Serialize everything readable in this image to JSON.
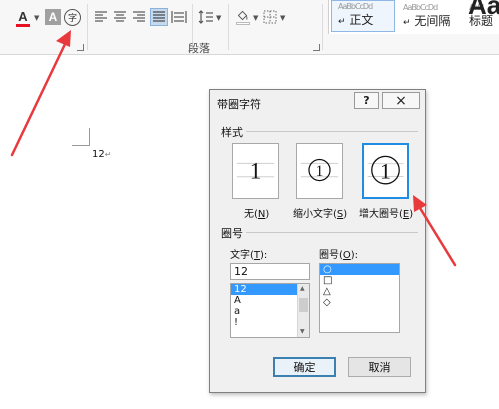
{
  "ribbon": {
    "font_color_label": "A",
    "char_shading_label": "A",
    "enclose_char_label": "字",
    "paragraph_group_label": "段落",
    "styles": [
      {
        "preview": "AaBbCcDd",
        "name": "正文",
        "marker": "↵",
        "selected": true
      },
      {
        "preview": "AaBbCcDd",
        "name": "无间隔",
        "marker": "↵",
        "selected": false
      },
      {
        "preview": "AaBl",
        "name": "标题",
        "selected": false
      }
    ],
    "big_style_glyph": "Aa"
  },
  "document": {
    "text": "12",
    "para_mark": "↵"
  },
  "dialog": {
    "title": "带圈字符",
    "help_label": "?",
    "close_label": "×",
    "style_section": "样式",
    "style_options": [
      {
        "label": "无",
        "hotkey": "N",
        "preview": "1",
        "selected": false
      },
      {
        "label": "缩小文字",
        "hotkey": "S",
        "preview": "1",
        "selected": false
      },
      {
        "label": "增大圈号",
        "hotkey": "E",
        "preview": "1",
        "selected": true
      }
    ],
    "enclosure_section": "圈号",
    "text_field_label": "文字",
    "text_field_hotkey": "T",
    "text_value": "12",
    "text_list": [
      "12",
      "A",
      "a",
      "!"
    ],
    "text_list_selected": 0,
    "enclosure_field_label": "圈号",
    "enclosure_field_hotkey": "O",
    "enclosure_list": [
      "○",
      "□",
      "△",
      "◇"
    ],
    "enclosure_list_selected": 0,
    "ok_label": "确定",
    "cancel_label": "取消"
  },
  "colors": {
    "font_color_bar": "#e81123",
    "arrow": "#e8393c",
    "selection": "#3399ff",
    "selected_style_border": "#1f8de4"
  }
}
